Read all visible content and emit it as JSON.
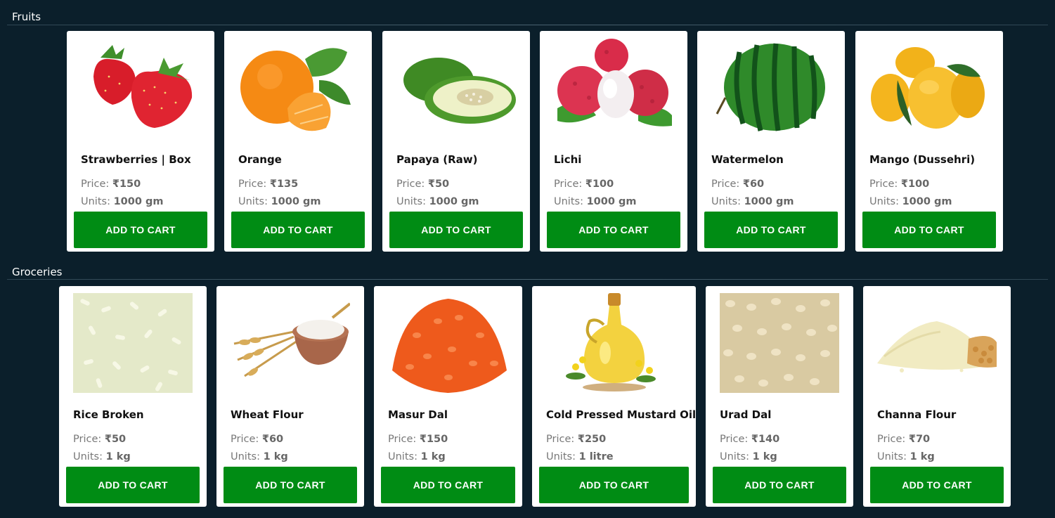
{
  "sections": [
    {
      "title": "Fruits",
      "products": [
        {
          "name": "Strawberries | Box",
          "price_label": "Price:",
          "price": "₹150",
          "units_label": "Units:",
          "units": "1000 gm",
          "image": "strawberry-image",
          "cta": "ADD TO CART"
        },
        {
          "name": "Orange",
          "price_label": "Price:",
          "price": "₹135",
          "units_label": "Units:",
          "units": "1000 gm",
          "image": "orange-image",
          "cta": "ADD TO CART"
        },
        {
          "name": "Papaya (Raw)",
          "price_label": "Price:",
          "price": "₹50",
          "units_label": "Units:",
          "units": "1000 gm",
          "image": "papaya-image",
          "cta": "ADD TO CART"
        },
        {
          "name": "Lichi",
          "price_label": "Price:",
          "price": "₹100",
          "units_label": "Units:",
          "units": "1000 gm",
          "image": "lichi-image",
          "cta": "ADD TO CART"
        },
        {
          "name": "Watermelon",
          "price_label": "Price:",
          "price": "₹60",
          "units_label": "Units:",
          "units": "1000 gm",
          "image": "watermelon-image",
          "cta": "ADD TO CART"
        },
        {
          "name": "Mango (Dussehri)",
          "price_label": "Price:",
          "price": "₹100",
          "units_label": "Units:",
          "units": "1000 gm",
          "image": "mango-image",
          "cta": "ADD TO CART"
        }
      ]
    },
    {
      "title": "Groceries",
      "products": [
        {
          "name": "Rice Broken",
          "price_label": "Price:",
          "price": "₹50",
          "units_label": "Units:",
          "units": "1 kg",
          "image": "rice-image",
          "cta": "ADD TO CART"
        },
        {
          "name": "Wheat Flour",
          "price_label": "Price:",
          "price": "₹60",
          "units_label": "Units:",
          "units": "1 kg",
          "image": "wheat-flour-image",
          "cta": "ADD TO CART"
        },
        {
          "name": "Masur Dal",
          "price_label": "Price:",
          "price": "₹150",
          "units_label": "Units:",
          "units": "1 kg",
          "image": "masur-dal-image",
          "cta": "ADD TO CART"
        },
        {
          "name": "Cold Pressed Mustard Oil",
          "price_label": "Price:",
          "price": "₹250",
          "units_label": "Units:",
          "units": "1 litre",
          "image": "mustard-oil-image",
          "cta": "ADD TO CART"
        },
        {
          "name": "Urad Dal",
          "price_label": "Price:",
          "price": "₹140",
          "units_label": "Units:",
          "units": "1 kg",
          "image": "urad-dal-image",
          "cta": "ADD TO CART"
        },
        {
          "name": "Channa Flour",
          "price_label": "Price:",
          "price": "₹70",
          "units_label": "Units:",
          "units": "1 kg",
          "image": "channa-flour-image",
          "cta": "ADD TO CART"
        }
      ]
    }
  ],
  "colors": {
    "background": "#0b1f2b",
    "card": "#ffffff",
    "button": "#008c14",
    "button_text": "#ffffff"
  }
}
